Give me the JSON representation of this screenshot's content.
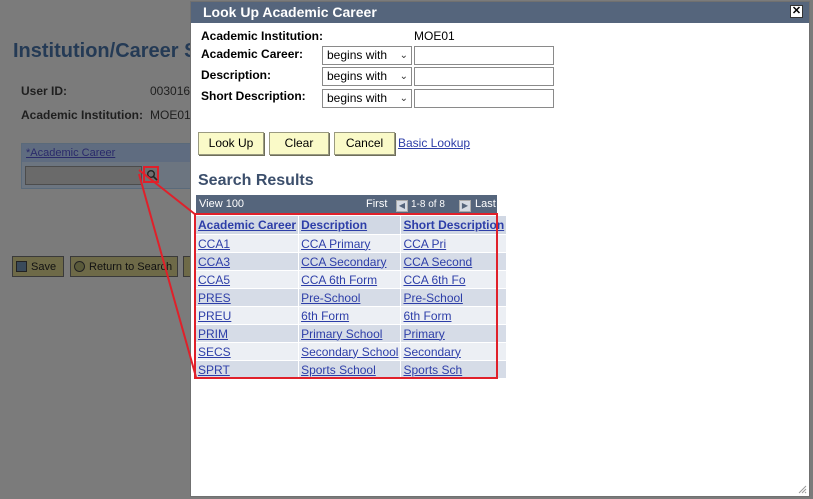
{
  "background": {
    "title": "Institution/Career Se",
    "user_id_label": "User ID:",
    "user_id_value": "003016",
    "institution_label": "Academic Institution:",
    "institution_value": "MOE01",
    "academic_career_link": "*Academic Career",
    "save_label": "Save",
    "return_label": "Return to Search"
  },
  "dialog": {
    "title": "Look Up Academic Career",
    "close_glyph": "✕",
    "institution_label": "Academic Institution:",
    "institution_value": "MOE01",
    "fields": [
      {
        "label": "Academic Career:",
        "operator": "begins with",
        "value": ""
      },
      {
        "label": "Description:",
        "operator": "begins with",
        "value": ""
      },
      {
        "label": "Short Description:",
        "operator": "begins with",
        "value": ""
      }
    ],
    "buttons": {
      "lookup": "Look Up",
      "clear": "Clear",
      "cancel": "Cancel"
    },
    "basic_lookup": "Basic Lookup",
    "results": {
      "title": "Search Results",
      "view": "View 100",
      "first": "First",
      "range": "1-8 of 8",
      "last": "Last",
      "headers": [
        "Academic Career",
        "Description",
        "Short Description"
      ],
      "rows": [
        [
          "CCA1",
          "CCA Primary",
          "CCA Pri"
        ],
        [
          "CCA3",
          "CCA Secondary",
          "CCA Second"
        ],
        [
          "CCA5",
          "CCA 6th Form",
          "CCA 6th Fo"
        ],
        [
          "PRES",
          "Pre-School",
          "Pre-School"
        ],
        [
          "PREU",
          "6th Form",
          "6th Form"
        ],
        [
          "PRIM",
          "Primary School",
          "Primary"
        ],
        [
          "SECS",
          "Secondary School",
          "Secondary"
        ],
        [
          "SPRT",
          "Sports School",
          "Sports Sch"
        ]
      ]
    }
  },
  "colors": {
    "title_bar": "#55657c",
    "button": "#fafac8",
    "highlight": "#e0202a",
    "link": "#2d3ea8"
  }
}
